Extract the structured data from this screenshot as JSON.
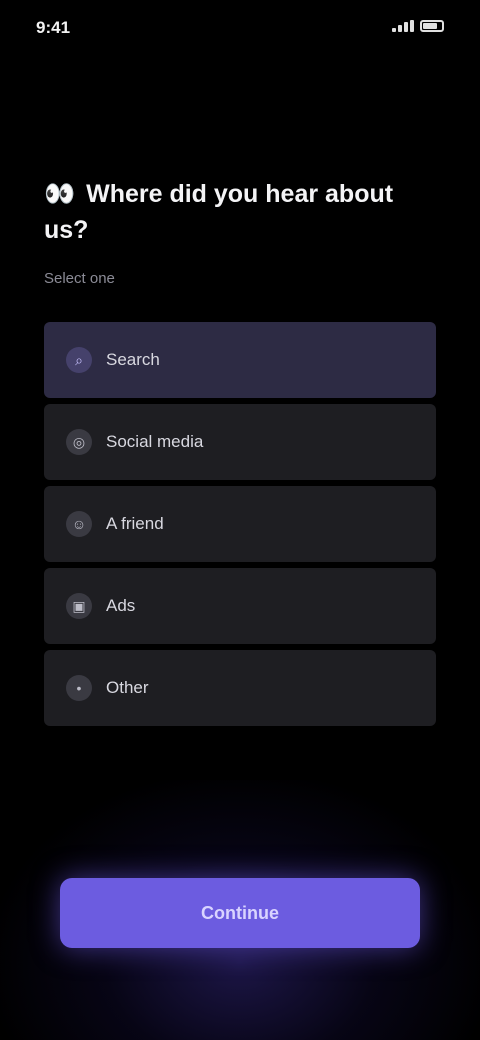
{
  "status_bar": {
    "time": "9:41"
  },
  "question": {
    "emoji": "👀",
    "text": "Where did you hear about us?"
  },
  "subtitle": "Select one",
  "options": [
    {
      "icon": "search-icon",
      "glyph": "⌕",
      "label": "Search",
      "selected": true
    },
    {
      "icon": "social-icon",
      "glyph": "◎",
      "label": "Social media",
      "selected": false
    },
    {
      "icon": "friend-icon",
      "glyph": "☺",
      "label": "A friend",
      "selected": false
    },
    {
      "icon": "ads-icon",
      "glyph": "▣",
      "label": "Ads",
      "selected": false
    },
    {
      "icon": "other-icon",
      "glyph": "•",
      "label": "Other",
      "selected": false
    }
  ],
  "continue_button": {
    "label": "Continue"
  },
  "colors": {
    "accent": "#6c5ce0",
    "option_bg": "#1e1e22",
    "option_selected_bg": "#2d2b44",
    "background": "#000000"
  }
}
